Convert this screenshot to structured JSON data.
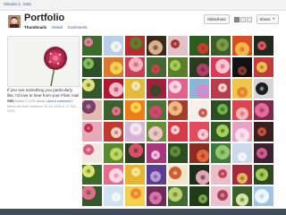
{
  "user": {
    "name": "Silvana C. Sola"
  },
  "header": {
    "title": "Portfolio",
    "views": [
      {
        "label": "Thumbnails",
        "active": true
      },
      {
        "label": "Detail",
        "active": false
      },
      {
        "label": "Comments",
        "active": false
      }
    ],
    "slideshow_label": "Slideshow",
    "share_label": "Share",
    "view_icons": [
      "grid-view-icon",
      "list-view-icon",
      "detail-view-icon"
    ]
  },
  "sidebar": {
    "description": "If you see something you particularly like, I'd love to hear from your Flickr mail me!",
    "views_count": "780 photos",
    "views_sep": " | ",
    "views_text": "1,078 views",
    "add_comment": "Add a comment?",
    "date_note": "Items are from between 15 Jul 2008 & 11 Sep 2010."
  },
  "colors": {
    "link": "#1f5fb0",
    "title": "#222222",
    "bottom_bar": "#3f4d5c"
  },
  "photos": [
    [
      "#3a6b2a",
      "#e87a9b"
    ],
    [
      "#b8d0e6",
      "#f2f2f2"
    ],
    [
      "#b52d2d",
      "#5a7f2b"
    ],
    [
      "#3b2a1a",
      "#d8b08a"
    ],
    [
      "#e3c1c8",
      "#a8302d"
    ],
    [
      "#2d5c1f",
      "#d33a2b"
    ],
    [
      "#3c5f2a",
      "#7a9b42"
    ],
    [
      "#d44e1f",
      "#f3b54a"
    ],
    [
      "#1e2a1c",
      "#e05058"
    ],
    [
      "#2f4f2a",
      "#7fbf5a"
    ],
    [
      "#d77a2f",
      "#f5d24d"
    ],
    [
      "#c84054",
      "#f0b3c0"
    ],
    [
      "#3f6a33",
      "#cf3f4c"
    ],
    [
      "#5a7f2b",
      "#a8c952"
    ],
    [
      "#2a3d1e",
      "#b43e6a"
    ],
    [
      "#d93a55",
      "#f6c7d2"
    ],
    [
      "#111111",
      "#8a3a2c"
    ],
    [
      "#c33a3a",
      "#e5c14d"
    ],
    [
      "#32582b",
      "#e2e07a"
    ],
    [
      "#b3162f",
      "#f0b8c9"
    ],
    [
      "#e3ba3a",
      "#efe7c4"
    ],
    [
      "#a0213b",
      "#2d4c22"
    ],
    [
      "#e7608d",
      "#f9d5e3"
    ],
    [
      "#8ab6d8",
      "#d48ac9"
    ],
    [
      "#b83b4f",
      "#f1d2c7"
    ],
    [
      "#f0c64d",
      "#e5862f"
    ],
    [
      "#d6d6d6",
      "#1d1d1d"
    ],
    [
      "#e4b9ae",
      "#7b3d6a"
    ],
    [
      "#3d612e",
      "#f06c8a"
    ],
    [
      "#ef7d1a",
      "#f8d548"
    ],
    [
      "#4c7434",
      "#d7426f"
    ],
    [
      "#a63a2c",
      "#f0b87a"
    ],
    [
      "#f6f0e8",
      "#c75a4a"
    ],
    [
      "#2f4d24",
      "#6ab24a"
    ],
    [
      "#d9464b",
      "#f3b6b8"
    ],
    [
      "#7a2c4a",
      "#e66a9a"
    ],
    [
      "#e8a9b8",
      "#c2304b"
    ],
    [
      "#c23a2f",
      "#e9d1c7"
    ],
    [
      "#d6b3d5",
      "#f3e3ee"
    ],
    [
      "#6a8f3a",
      "#f2c3cf"
    ],
    [
      "#d63a45",
      "#f5d4d7"
    ],
    [
      "#e34b5a",
      "#fbd0d6"
    ],
    [
      "#2f5a25",
      "#a6d05a"
    ],
    [
      "#e8a1c2",
      "#fae0ea"
    ],
    [
      "#3a1f1f",
      "#c44f3a"
    ],
    [
      "#f4e7e3",
      "#d85b7a"
    ],
    [
      "#5a8a2f",
      "#c0d65e"
    ],
    [
      "#2b3f1e",
      "#e04d6a"
    ],
    [
      "#a7367d",
      "#f0c0df"
    ],
    [
      "#2b4d22",
      "#5d8d36"
    ],
    [
      "#8a2c1f",
      "#e2683a"
    ],
    [
      "#3d7a3f",
      "#98c66b"
    ],
    [
      "#cbd9ea",
      "#f7f7f7"
    ],
    [
      "#3b2230",
      "#d45a8d"
    ],
    [
      "#3c6a2a",
      "#dbe36a"
    ],
    [
      "#e36b8e",
      "#fbd8e4"
    ],
    [
      "#e6b530",
      "#f6e59a"
    ],
    [
      "#5a3f8f",
      "#b79ad8"
    ],
    [
      "#f1e5c8",
      "#d45a2f"
    ],
    [
      "#1b2e18",
      "#e6a4b8"
    ],
    [
      "#e8c0c9",
      "#c64054"
    ],
    [
      "#a32c3c",
      "#e4b65a"
    ],
    [
      "#2d4a22",
      "#a6c957"
    ],
    [
      "#2f5a2a",
      "#e06e8a"
    ],
    [
      "#cfe3f0",
      "#f8f8f8"
    ],
    [
      "#f2d04c",
      "#e98a2d"
    ],
    [
      "#6b2c5a",
      "#d773a6"
    ],
    [
      "#3f6a33",
      "#b9d06a"
    ],
    [
      "#203b18",
      "#7aa74a"
    ],
    [
      "#e9c2cd",
      "#b3405c"
    ],
    [
      "#3a5f2a",
      "#d4e6a0"
    ],
    [
      "#9fc3e3",
      "#eef6fb"
    ]
  ]
}
